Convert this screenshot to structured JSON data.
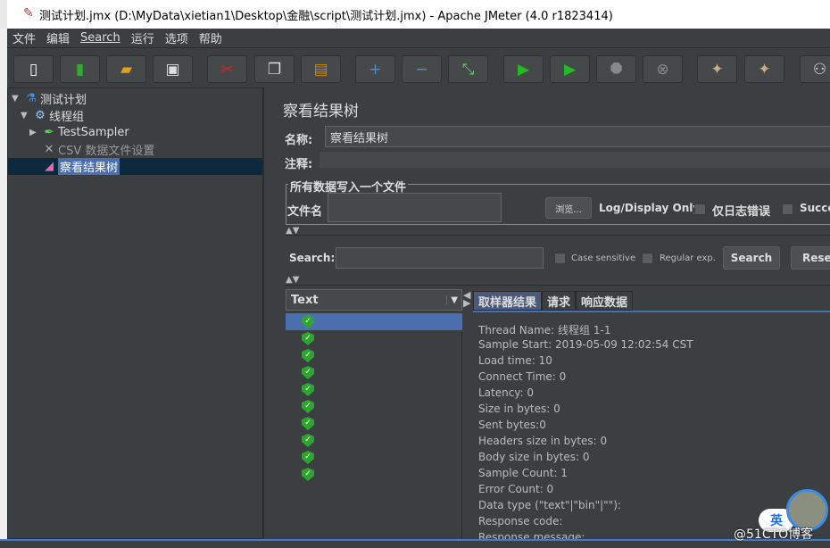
{
  "window": {
    "title": "测试计划.jmx (D:\\MyData\\xietian1\\Desktop\\金融\\script\\测试计划.jmx) - Apache JMeter (4.0 r1823414)"
  },
  "menu": [
    "文件",
    "编辑",
    "Search",
    "运行",
    "选项",
    "帮助"
  ],
  "toolbar": [
    "new-icon",
    "templates-icon",
    "open-icon",
    "save-icon",
    "cut-icon",
    "copy-icon",
    "paste-icon",
    "expand-icon",
    "collapse-icon",
    "toggle-icon",
    "start-icon",
    "start-no-pause-icon",
    "stop-icon",
    "shutdown-icon",
    "clear-icon",
    "clear-all-icon",
    "search-binoculars-icon"
  ],
  "tree": [
    {
      "label": "测试计划",
      "icon": "flask-icon",
      "expanded": true
    },
    {
      "label": "线程组",
      "icon": "gear-icon",
      "expanded": true
    },
    {
      "label": "TestSampler",
      "icon": "pipette-icon",
      "expanded": false
    },
    {
      "label": "CSV 数据文件设置",
      "icon": "tools-icon"
    },
    {
      "label": "察看结果树",
      "icon": "chart-icon",
      "selected": true
    }
  ],
  "panel": {
    "title": "察看结果树",
    "name_label": "名称:",
    "name_value": "察看结果树",
    "comment_label": "注释:",
    "file_group": "所有数据写入一个文件",
    "filename_label": "文件名",
    "browse": "浏览...",
    "log_only": "Log/Display Only:",
    "errors_only": "仅日志错误",
    "successes": "Succe",
    "search_label": "Search:",
    "case_sensitive": "Case sensitive",
    "regex": "Regular exp.",
    "search_btn": "Search",
    "reset_btn": "Reset",
    "renderer": "Text",
    "tabs": [
      "取样器结果",
      "请求",
      "响应数据"
    ],
    "results_count": 10,
    "info": [
      "Thread Name: 线程组 1-1",
      "Sample Start: 2019-05-09 12:02:54 CST",
      "Load time: 10",
      "Connect Time: 0",
      "Latency: 0",
      "Size in bytes: 0",
      "Sent bytes:0",
      "Headers size in bytes: 0",
      "Body size in bytes: 0",
      "Sample Count: 1",
      "Error Count: 0",
      "Data type (\"text\"|\"bin\"|\"\"):",
      "Response code:",
      "Response message:"
    ]
  },
  "overlay": {
    "ime": "英",
    "watermark": "@51CTO博客"
  }
}
